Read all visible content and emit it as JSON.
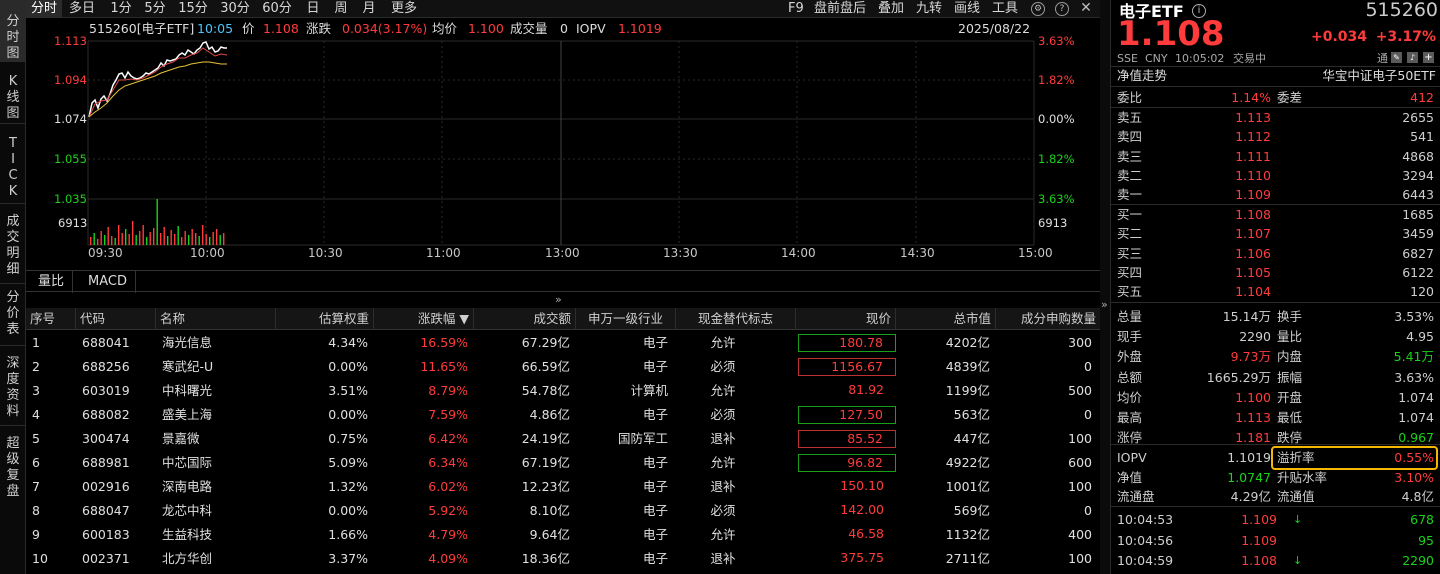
{
  "vnav": [
    "分\n时\n图",
    "K\n线\n图",
    "T\nI\nC\nK",
    "成\n交\n明\n细",
    "分\n价\n表",
    "深\n度\n资\n料",
    "超\n级\n复\n盘"
  ],
  "top_tabs": [
    "分时",
    "多日",
    "1分",
    "5分",
    "15分",
    "30分",
    "60分",
    "日",
    "周",
    "月",
    "更多"
  ],
  "top_right": [
    "F9",
    "盘前盘后",
    "叠加",
    "九转",
    "画线",
    "工具"
  ],
  "chart_info": {
    "code_name": "515260[电子ETF]",
    "time": "10:05",
    "price_label": "价",
    "price": "1.108",
    "change_label": "涨跌",
    "change": "0.034(3.17%)",
    "avg_label": "均价",
    "avg": "1.100",
    "volume_label": "成交量",
    "volume": "0",
    "iopv_label": "IOPV",
    "iopv": "1.1019",
    "date": "2025/08/22"
  },
  "y_left": [
    "1.113",
    "1.094",
    "1.074",
    "1.055",
    "1.035",
    "6913"
  ],
  "y_right": [
    "3.63%",
    "1.82%",
    "0.00%",
    "1.82%",
    "3.63%",
    "6913"
  ],
  "time_axis": [
    "09:30",
    "10:00",
    "10:30",
    "11:00",
    "13:00",
    "13:30",
    "14:00",
    "14:30",
    "15:00"
  ],
  "sub_tabs": [
    "量比",
    "MACD"
  ],
  "table_headers": [
    "序号",
    "代码",
    "名称",
    "估算权重",
    "涨跌幅 ▼",
    "成交额",
    "申万一级行业",
    "现金替代标志",
    "现价",
    "总市值",
    "成分申购数量"
  ],
  "table_rows": [
    {
      "idx": "1",
      "code": "688041",
      "name": "海光信息",
      "weight": "4.34%",
      "chg": "16.59%",
      "amount": "67.29亿",
      "industry": "电子",
      "flag": "允许",
      "price": "180.78",
      "box": "green",
      "mcap": "4202亿",
      "qty": "300"
    },
    {
      "idx": "2",
      "code": "688256",
      "name": "寒武纪-U",
      "weight": "0.00%",
      "chg": "11.65%",
      "amount": "66.59亿",
      "industry": "电子",
      "flag": "必须",
      "price": "1156.67",
      "box": "red",
      "mcap": "4839亿",
      "qty": "0"
    },
    {
      "idx": "3",
      "code": "603019",
      "name": "中科曙光",
      "weight": "3.51%",
      "chg": "8.79%",
      "amount": "54.78亿",
      "industry": "计算机",
      "flag": "允许",
      "price": "81.92",
      "box": "",
      "mcap": "1199亿",
      "qty": "500"
    },
    {
      "idx": "4",
      "code": "688082",
      "name": "盛美上海",
      "weight": "0.00%",
      "chg": "7.59%",
      "amount": "4.86亿",
      "industry": "电子",
      "flag": "必须",
      "price": "127.50",
      "box": "green",
      "mcap": "563亿",
      "qty": "0"
    },
    {
      "idx": "5",
      "code": "300474",
      "name": "景嘉微",
      "weight": "0.75%",
      "chg": "6.42%",
      "amount": "24.19亿",
      "industry": "国防军工",
      "flag": "退补",
      "price": "85.52",
      "box": "red",
      "mcap": "447亿",
      "qty": "100"
    },
    {
      "idx": "6",
      "code": "688981",
      "name": "中芯国际",
      "weight": "5.09%",
      "chg": "6.34%",
      "amount": "67.19亿",
      "industry": "电子",
      "flag": "允许",
      "price": "96.82",
      "box": "green",
      "mcap": "4922亿",
      "qty": "600"
    },
    {
      "idx": "7",
      "code": "002916",
      "name": "深南电路",
      "weight": "1.32%",
      "chg": "6.02%",
      "amount": "12.23亿",
      "industry": "电子",
      "flag": "退补",
      "price": "150.10",
      "box": "",
      "mcap": "1001亿",
      "qty": "100"
    },
    {
      "idx": "8",
      "code": "688047",
      "name": "龙芯中科",
      "weight": "0.00%",
      "chg": "5.92%",
      "amount": "8.10亿",
      "industry": "电子",
      "flag": "必须",
      "price": "142.00",
      "box": "",
      "mcap": "569亿",
      "qty": "0"
    },
    {
      "idx": "9",
      "code": "600183",
      "name": "生益科技",
      "weight": "1.66%",
      "chg": "4.79%",
      "amount": "9.64亿",
      "industry": "电子",
      "flag": "允许",
      "price": "46.58",
      "box": "",
      "mcap": "1132亿",
      "qty": "400"
    },
    {
      "idx": "10",
      "code": "002371",
      "name": "北方华创",
      "weight": "3.37%",
      "chg": "4.09%",
      "amount": "18.36亿",
      "industry": "电子",
      "flag": "退补",
      "price": "375.75",
      "box": "",
      "mcap": "2711亿",
      "qty": "100"
    }
  ],
  "right": {
    "name": "电子ETF",
    "code": "515260",
    "price": "1.108",
    "change": "+0.034",
    "pct": "+3.17%",
    "exch": "SSE",
    "cur": "CNY",
    "time": "10:05:02",
    "status": "交易中",
    "tong": "通",
    "trend_label": "净值走势",
    "index_name": "华宝中证电子50ETF",
    "weibi_label": "委比",
    "weibi": "1.14%",
    "weicha_label": "委差",
    "weicha": "412",
    "sells": [
      {
        "label": "卖五",
        "price": "1.113",
        "vol": "2655"
      },
      {
        "label": "卖四",
        "price": "1.112",
        "vol": "541"
      },
      {
        "label": "卖三",
        "price": "1.111",
        "vol": "4868"
      },
      {
        "label": "卖二",
        "price": "1.110",
        "vol": "3294"
      },
      {
        "label": "卖一",
        "price": "1.109",
        "vol": "6443"
      }
    ],
    "buys": [
      {
        "label": "买一",
        "price": "1.108",
        "vol": "1685"
      },
      {
        "label": "买二",
        "price": "1.107",
        "vol": "3459"
      },
      {
        "label": "买三",
        "price": "1.106",
        "vol": "6827"
      },
      {
        "label": "买四",
        "price": "1.105",
        "vol": "6122"
      },
      {
        "label": "买五",
        "price": "1.104",
        "vol": "120"
      }
    ],
    "stats": [
      [
        "总量",
        "15.14万",
        "换手",
        "3.53%"
      ],
      [
        "现手",
        "2290",
        "量比",
        "4.95"
      ],
      [
        "外盘",
        "9.73万",
        "内盘",
        "5.41万"
      ],
      [
        "总额",
        "1665.29万",
        "振幅",
        "3.63%"
      ],
      [
        "均价",
        "1.100",
        "开盘",
        "1.074"
      ],
      [
        "最高",
        "1.113",
        "最低",
        "1.074"
      ],
      [
        "涨停",
        "1.181",
        "跌停",
        "0.967"
      ]
    ],
    "stats2": [
      [
        "IOPV",
        "1.1019",
        "溢折率",
        "0.55%"
      ],
      [
        "净值",
        "1.0747",
        "升贴水率",
        "3.10%"
      ],
      [
        "流通盘",
        "4.29亿",
        "流通值",
        "4.8亿"
      ]
    ],
    "ticks": [
      {
        "time": "10:04:53",
        "price": "1.109",
        "arrow": "↓",
        "vol": "678"
      },
      {
        "time": "10:04:56",
        "price": "1.109",
        "arrow": "",
        "vol": "95"
      },
      {
        "time": "10:04:59",
        "price": "1.108",
        "arrow": "↓",
        "vol": "2290"
      }
    ]
  },
  "colors": {
    "up": "#ff3b3b",
    "down": "#19d219",
    "highlight": "#f5b800"
  }
}
